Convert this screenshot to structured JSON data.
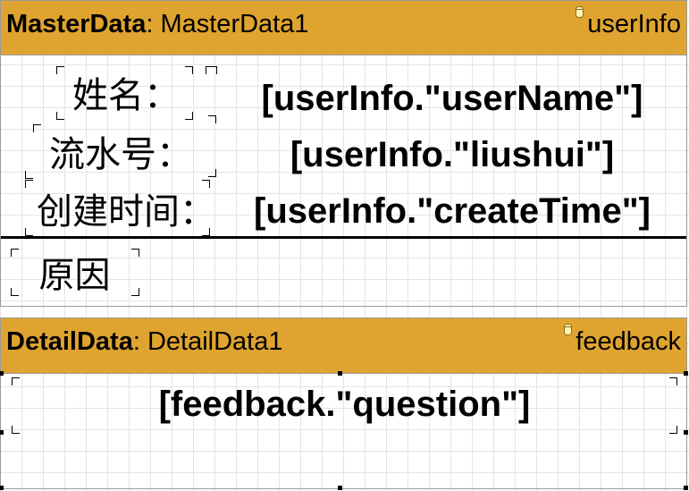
{
  "master_band": {
    "type_label": "MasterData",
    "separator": ":",
    "name": "MasterData1",
    "datasource_icon": "database-icon",
    "datasource": "userInfo",
    "header_color": "#dfa42f",
    "labels": {
      "name": "姓名：",
      "serial": "流水号：",
      "created": "创建时间：",
      "reason": "原因"
    },
    "fields": {
      "user_name": "[userInfo.\"userName\"]",
      "serial": "[userInfo.\"liushui\"]",
      "create_time": "[userInfo.\"createTime\"]"
    }
  },
  "detail_band": {
    "type_label": "DetailData",
    "separator": ":",
    "name": "DetailData1",
    "datasource_icon": "database-icon",
    "datasource": "feedback",
    "header_color": "#dfa42f",
    "fields": {
      "question": "[feedback.\"question\"]"
    }
  }
}
